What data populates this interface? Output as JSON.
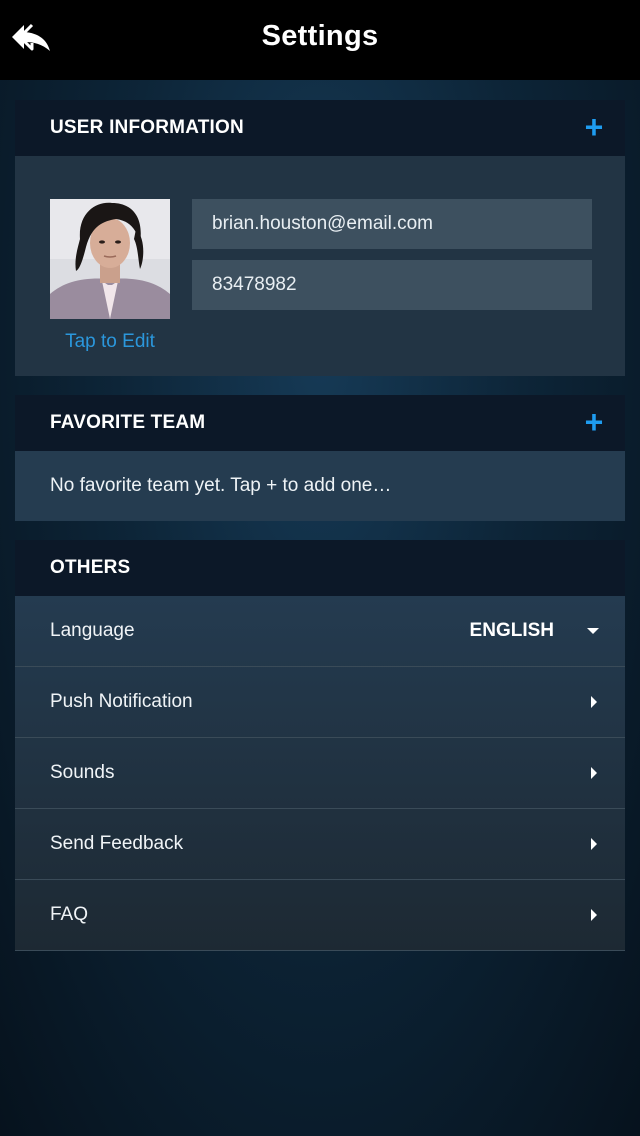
{
  "header": {
    "title": "Settings",
    "back_icon": "reply-arrow-icon"
  },
  "user_info": {
    "title": "USER INFORMATION",
    "add_icon": "plus-icon",
    "avatar_edit_label": "Tap to Edit",
    "email": "brian.houston@email.com",
    "phone": "83478982"
  },
  "favorite_team": {
    "title": "FAVORITE TEAM",
    "add_icon": "plus-icon",
    "empty_text": "No favorite team yet. Tap + to add one…"
  },
  "others": {
    "title": "OTHERS",
    "language": {
      "label": "Language",
      "value": "ENGLISH"
    },
    "items": [
      {
        "label": "Push Notification"
      },
      {
        "label": "Sounds"
      },
      {
        "label": "Send Feedback"
      },
      {
        "label": "FAQ"
      }
    ]
  },
  "colors": {
    "accent": "#1e9cf0",
    "header_bar": "#000000",
    "section_header": "#0c1828",
    "section_body": "#223444"
  }
}
